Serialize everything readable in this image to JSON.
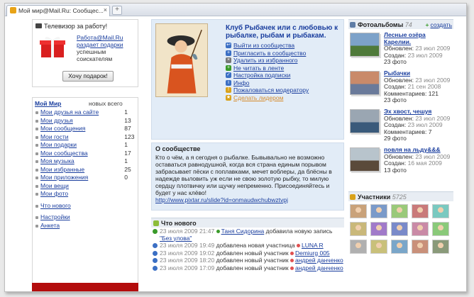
{
  "browser": {
    "tab_title": "Мой мир@Mail.Ru: Сообщес...",
    "close": "×",
    "new_tab": "+"
  },
  "promo": {
    "title": "Телевизор за работу!",
    "link_text": "Работа@Mail.Ru раздает подарки",
    "text": "успешным соискателям",
    "button": "Хочу подарок!"
  },
  "stats": {
    "title": "Мой Мир",
    "cols": "новых всего",
    "groups": [
      [
        {
          "label": "Мои друзья на сайте",
          "new": "",
          "total": "1"
        },
        {
          "label": "Мои друзья",
          "new": "",
          "total": "13"
        },
        {
          "label": "Мои сообщения",
          "new": "",
          "total": "87"
        },
        {
          "label": "Мои гости",
          "new": "",
          "total": "123"
        },
        {
          "label": "Мои подарки",
          "new": "",
          "total": "1"
        },
        {
          "label": "Мои сообщества",
          "new": "",
          "total": "17"
        },
        {
          "label": "Моя музыка",
          "new": "",
          "total": "1"
        },
        {
          "label": "Мои избранные",
          "new": "",
          "total": "25"
        },
        {
          "label": "Мои приложения",
          "new": "",
          "total": "0"
        },
        {
          "label": "Мои вещи",
          "new": "",
          "total": ""
        },
        {
          "label": "Мои фото",
          "new": "",
          "total": ""
        }
      ],
      [
        {
          "label": "Что нового",
          "new": "",
          "total": ""
        }
      ],
      [
        {
          "label": "Настройки",
          "new": "",
          "total": ""
        },
        {
          "label": "Анкета",
          "new": "",
          "total": ""
        }
      ]
    ]
  },
  "club": {
    "title": "Клуб Рыбачек или с любовью к рыбалке, рыбам и рыбакам.",
    "links": [
      {
        "label": "Выйти из сообщества",
        "icon": "exit-icon",
        "color": "#3b6fc4"
      },
      {
        "label": "Пригласить в сообщество",
        "icon": "invite-icon",
        "color": "#3b6fc4"
      },
      {
        "label": "Удалить из избранного",
        "icon": "remove-icon",
        "color": "#777777"
      },
      {
        "label": "Не читать в ленте",
        "icon": "feed-icon",
        "color": "#3a9a2a"
      },
      {
        "label": "Настройка подписки",
        "icon": "subscription-icon",
        "color": "#3b6fc4"
      },
      {
        "label": "Инфо",
        "icon": "info-icon",
        "color": "#3b6fc4"
      },
      {
        "label": "Пожаловаться модератору",
        "icon": "complain-icon",
        "color": "#d9a21a"
      },
      {
        "label": "Сделать лидером",
        "icon": "leader-icon",
        "color": "#d9a21a"
      }
    ]
  },
  "about": {
    "title": "О сообществе",
    "text": "Кто о чём, а я сегодня о рыбалке. Бывывально не возможно оставаться равнодушной, когда вся страна единым порывом забрасывает пёски с поплавками, мечет воблеры, да блёсны в надежде выловить уж если не свою золотую рыбку, то милую сердцу плотвичку или щучку непременно. Присоединяйтесь и будет у нас клёво!",
    "link": "http://www.pixtar.ru/slide?id=onmaudwchubwztvpj"
  },
  "news": {
    "title": "Что нового",
    "rows": [
      {
        "date": "23 июля 2009 21:47",
        "user": "Таня Сидорина",
        "action": "добавила новую запись",
        "extra": "\"Без улова\"",
        "color": "#3a9a2a"
      },
      {
        "date": "23 июля 2009 19:49",
        "user": "",
        "action": "добавлена новая участница",
        "extra": "LUNA R",
        "color": "#3b6fc4"
      },
      {
        "date": "23 июля 2009 19:02",
        "user": "",
        "action": "добавлен новый участник",
        "extra": "Demiurg 005",
        "color": "#3b6fc4"
      },
      {
        "date": "23 июля 2009 18:20",
        "user": "",
        "action": "добавлен новый участник",
        "extra": "андрей данченко",
        "color": "#3b6fc4"
      },
      {
        "date": "23 июля 2009 17:09",
        "user": "",
        "action": "добавлен новый участник",
        "extra": "андрей данченко",
        "color": "#3b6fc4"
      }
    ]
  },
  "albums": {
    "title": "Фотоальбомы",
    "count": "74",
    "create": "создать",
    "items": [
      {
        "name": "Лесные озёра Карелии.",
        "updated_label": "Обновлен:",
        "updated": "23 июл 2009",
        "created_label": "Создан:",
        "created": "23 июл 2009",
        "comments": "",
        "photos": "23 фото"
      },
      {
        "name": "Рыбачки",
        "updated_label": "Обновлен:",
        "updated": "23 июл 2009",
        "created_label": "Создан:",
        "created": "21 сен 2008",
        "comments": "Комментариев: 121",
        "photos": "23 фото"
      },
      {
        "name": "Эх хвост, чешуя",
        "updated_label": "Обновлен:",
        "updated": "23 июл 2009",
        "created_label": "Создан:",
        "created": "23 июл 2009",
        "comments": "Комментариев: 7",
        "photos": "29 фото"
      },
      {
        "name": "повля на льду&&&",
        "updated_label": "Обновлен:",
        "updated": "23 июл 2009",
        "created_label": "Создан:",
        "created": "16 мая 2009",
        "comments": "",
        "photos": "13 фото"
      }
    ]
  },
  "members": {
    "title": "Участники",
    "count": "5725"
  }
}
